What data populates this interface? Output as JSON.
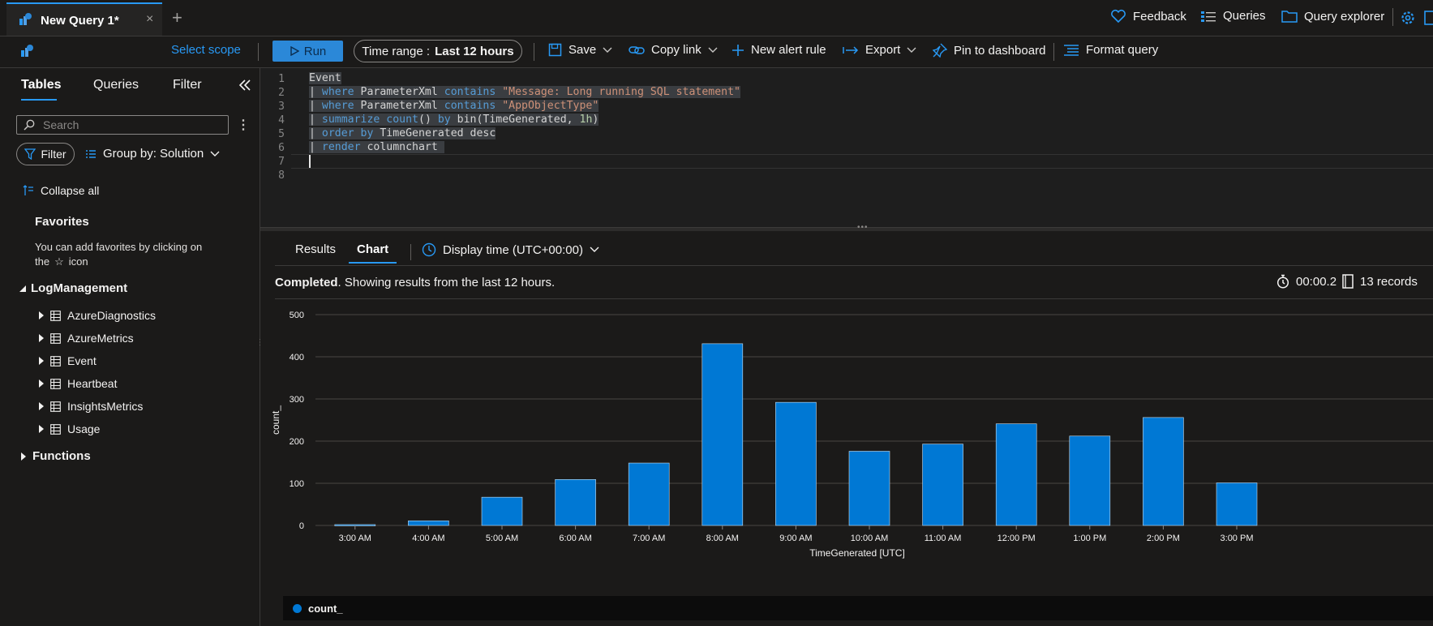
{
  "titlebar": {
    "tab_label": "New Query 1*",
    "close_glyph": "×",
    "add_glyph": "+",
    "feedback_label": "Feedback",
    "queries_label": "Queries",
    "query_explorer_label": "Query explorer"
  },
  "toolbar": {
    "select_scope_label": "Select scope",
    "run_label": "Run",
    "time_range_prefix": "Time range :",
    "time_range_value": "Last 12 hours",
    "save_label": "Save",
    "copy_link_label": "Copy link",
    "new_alert_label": "New alert rule",
    "export_label": "Export",
    "pin_label": "Pin to dashboard",
    "format_label": "Format query"
  },
  "sidebar": {
    "tabs": [
      "Tables",
      "Queries",
      "Filter"
    ],
    "search_placeholder": "Search",
    "filter_label": "Filter",
    "group_by_label": "Group by: Solution",
    "collapse_all_label": "Collapse all",
    "favorites_heading": "Favorites",
    "favorites_text_1": "You can add favorites by clicking on",
    "favorites_text_2": "the",
    "favorites_text_3": "icon",
    "log_management_label": "LogManagement",
    "tables": [
      "AzureDiagnostics",
      "AzureMetrics",
      "Event",
      "Heartbeat",
      "InsightsMetrics",
      "Usage"
    ],
    "functions_label": "Functions"
  },
  "editor": {
    "line_numbers": [
      "1",
      "2",
      "3",
      "4",
      "5",
      "6",
      "7",
      "8"
    ],
    "line1": "Event",
    "line2_a": "| ",
    "line2_kw": "where",
    "line2_b": " ParameterXml ",
    "line2_kw2": "contains",
    "line2_str": " \"Message: Long running SQL statement\"",
    "line3_a": "| ",
    "line3_kw": "where",
    "line3_b": " ParameterXml ",
    "line3_kw2": "contains",
    "line3_str": " \"AppObjectType\"",
    "line4_a": "| ",
    "line4_kw": "summarize",
    "line4_kw2": " count",
    "line4_b": "() ",
    "line4_kw3": "by",
    "line4_c": " bin(TimeGenerated, ",
    "line4_num": "1h",
    "line4_d": ")",
    "line5_a": "| ",
    "line5_kw": "order",
    "line5_kw2": " by",
    "line5_b": " TimeGenerated desc",
    "line6_a": "| ",
    "line6_kw": "render",
    "line6_b": " columnchart "
  },
  "results": {
    "results_tab": "Results",
    "chart_tab": "Chart",
    "display_time_label": "Display time (UTC+00:00)",
    "status_bold": "Completed",
    "status_rest": ". Showing results from the last 12 hours.",
    "elapsed": "00:00.2",
    "records": "13 records"
  },
  "colors": {
    "accent": "#2899f5",
    "bar": "#0078d4",
    "run_button": "#2b88d8"
  },
  "chart_data": {
    "type": "bar",
    "categories": [
      "3:00 AM",
      "4:00 AM",
      "5:00 AM",
      "6:00 AM",
      "7:00 AM",
      "8:00 AM",
      "9:00 AM",
      "10:00 AM",
      "11:00 AM",
      "12:00 PM",
      "1:00 PM",
      "2:00 PM",
      "3:00 PM"
    ],
    "series": [
      {
        "name": "count_",
        "values": [
          2,
          11,
          67,
          109,
          148,
          431,
          292,
          176,
          193,
          241,
          212,
          256,
          101
        ]
      }
    ],
    "xlabel": "TimeGenerated [UTC]",
    "ylabel": "count_",
    "ylim": [
      0,
      500
    ],
    "yticks": [
      "0",
      "100",
      "200",
      "300",
      "400",
      "500"
    ],
    "grid": true,
    "legend": "bottom"
  }
}
